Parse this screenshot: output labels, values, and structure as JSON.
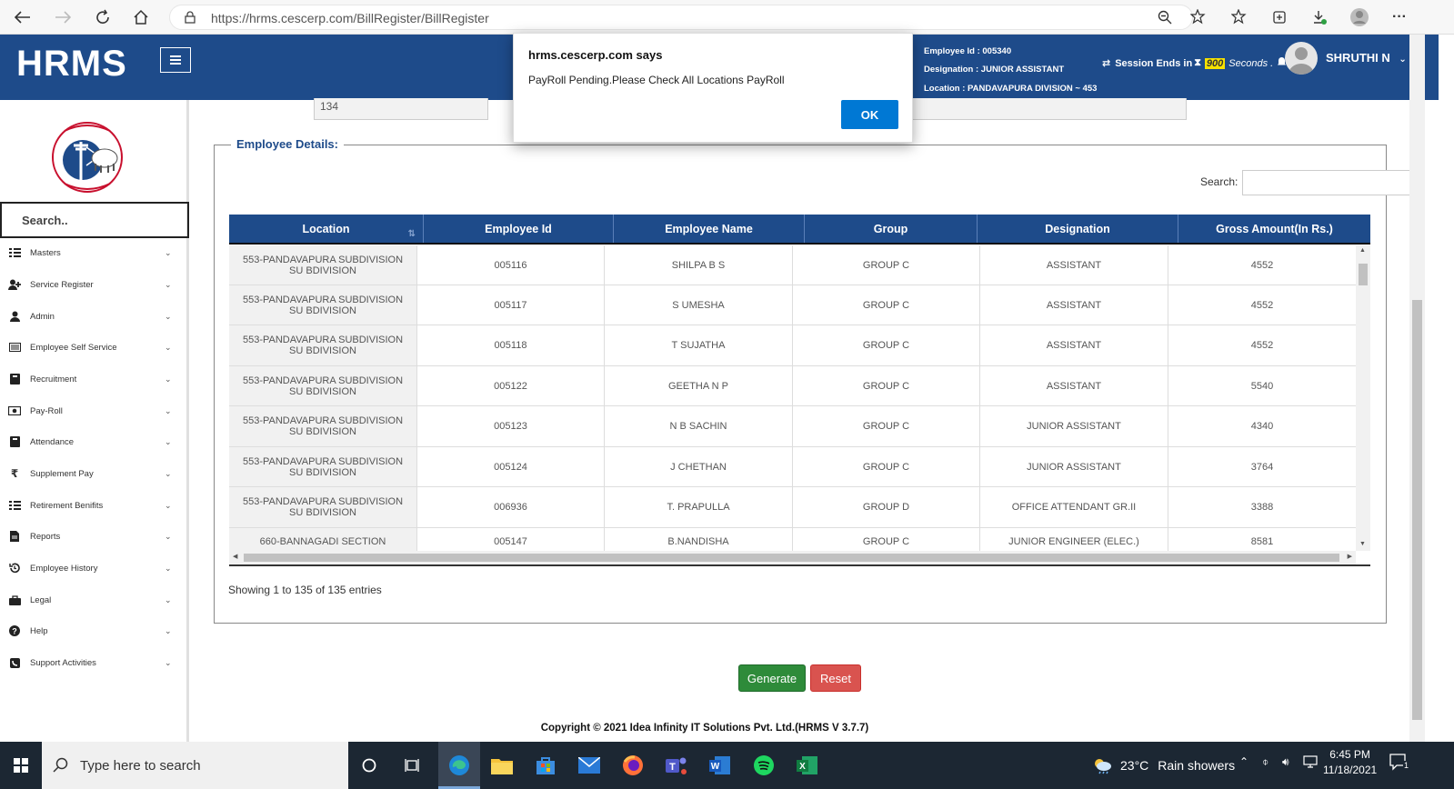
{
  "browser": {
    "url": "https://hrms.cescerp.com/BillRegister/BillRegister"
  },
  "header": {
    "brand": "HRMS",
    "employee_id": "Employee Id : 005340",
    "designation": "Designation : JUNIOR ASSISTANT",
    "location": "Location : PANDAVAPURA DIVISION ~ 453",
    "session_prefix": "Session Ends in",
    "session_count": "900",
    "session_suffix": "Seconds .",
    "user_name": "SHRUTHI N"
  },
  "sidebar": {
    "search_placeholder": "Search..",
    "items": [
      {
        "label": "Masters",
        "icon": "list-icon"
      },
      {
        "label": "Service Register",
        "icon": "user-plus-icon"
      },
      {
        "label": "Admin",
        "icon": "user-icon"
      },
      {
        "label": "Employee Self Service",
        "icon": "card-icon"
      },
      {
        "label": "Recruitment",
        "icon": "book-icon"
      },
      {
        "label": "Pay-Roll",
        "icon": "money-icon"
      },
      {
        "label": "Attendance",
        "icon": "book-icon"
      },
      {
        "label": "Supplement Pay",
        "icon": "rupee-icon"
      },
      {
        "label": "Retirement Benifits",
        "icon": "list-icon"
      },
      {
        "label": "Reports",
        "icon": "file-icon"
      },
      {
        "label": "Employee History",
        "icon": "history-icon"
      },
      {
        "label": "Legal",
        "icon": "briefcase-icon"
      },
      {
        "label": "Help",
        "icon": "question-icon"
      },
      {
        "label": "Support Activities",
        "icon": "phone-icon"
      }
    ]
  },
  "main": {
    "prev_field_value": "134",
    "section_title": "Employee Details:",
    "search_label": "Search:",
    "table": {
      "columns": [
        "Location",
        "Employee Id",
        "Employee Name",
        "Group",
        "Designation",
        "Gross Amount(In Rs.)"
      ],
      "rows": [
        [
          "553-PANDAVAPURA SUBDIVISION SU BDIVISION",
          "005116",
          "SHILPA B S",
          "GROUP C",
          "ASSISTANT",
          "4552"
        ],
        [
          "553-PANDAVAPURA SUBDIVISION SU BDIVISION",
          "005117",
          "S UMESHA",
          "GROUP C",
          "ASSISTANT",
          "4552"
        ],
        [
          "553-PANDAVAPURA SUBDIVISION SU BDIVISION",
          "005118",
          "T SUJATHA",
          "GROUP C",
          "ASSISTANT",
          "4552"
        ],
        [
          "553-PANDAVAPURA SUBDIVISION SU BDIVISION",
          "005122",
          "GEETHA N P",
          "GROUP C",
          "ASSISTANT",
          "5540"
        ],
        [
          "553-PANDAVAPURA SUBDIVISION SU BDIVISION",
          "005123",
          "N B SACHIN",
          "GROUP C",
          "JUNIOR ASSISTANT",
          "4340"
        ],
        [
          "553-PANDAVAPURA SUBDIVISION SU BDIVISION",
          "005124",
          "J CHETHAN",
          "GROUP C",
          "JUNIOR ASSISTANT",
          "3764"
        ],
        [
          "553-PANDAVAPURA SUBDIVISION SU BDIVISION",
          "006936",
          "T. PRAPULLA",
          "GROUP D",
          "OFFICE ATTENDANT GR.II",
          "3388"
        ],
        [
          "660-BANNAGADI SECTION",
          "005147",
          "B.NANDISHA",
          "GROUP C",
          "JUNIOR ENGINEER (ELEC.)",
          "8581"
        ]
      ]
    },
    "showing_text": "Showing 1 to 135 of 135 entries",
    "generate_label": "Generate",
    "reset_label": "Reset",
    "copyright": "Copyright © 2021 Idea Infinity IT Solutions Pvt. Ltd.(HRMS V 3.7.7)"
  },
  "dialog": {
    "title": "hrms.cescerp.com says",
    "message": "PayRoll Pending.Please Check All Locations PayRoll",
    "ok_label": "OK"
  },
  "taskbar": {
    "search_placeholder": "Type here to search",
    "weather_temp": "23°C",
    "weather_desc": "Rain showers",
    "time": "6:45 PM",
    "date": "11/18/2021",
    "notification_count": "1"
  },
  "colors": {
    "brand_blue": "#1e4b8a",
    "generate_green": "#2e8b3a",
    "reset_red": "#d9534f",
    "dialog_ok_blue": "#0078d4"
  }
}
